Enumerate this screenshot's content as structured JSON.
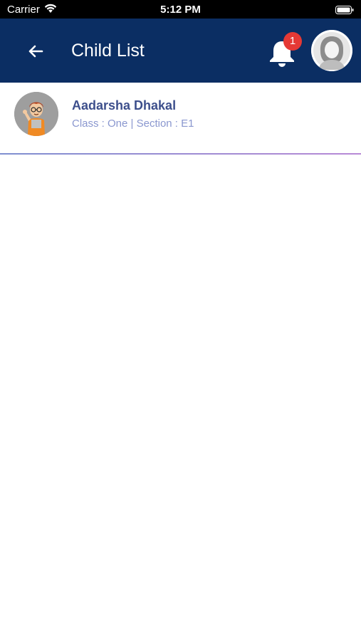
{
  "status_bar": {
    "carrier": "Carrier",
    "time": "5:12 PM",
    "wifi_icon": "wifi-icon",
    "battery_icon": "battery-icon"
  },
  "header": {
    "title": "Child List",
    "back_icon": "arrow-left-icon",
    "notification_icon": "bell-icon",
    "notification_count": "1",
    "profile_icon": "user-avatar-icon",
    "background_color": "#0b2e63",
    "badge_color": "#e53935"
  },
  "children": [
    {
      "name": "Aadarsha Dhakal",
      "class_label": "Class",
      "class_value": "One",
      "section_label": "Section",
      "section_value": "E1",
      "meta_text": "Class : One | Section : E1",
      "avatar_icon": "boy-cartoon-avatar-icon"
    }
  ],
  "colors": {
    "name_text": "#3d4f8c",
    "meta_text": "#8a97cf"
  }
}
